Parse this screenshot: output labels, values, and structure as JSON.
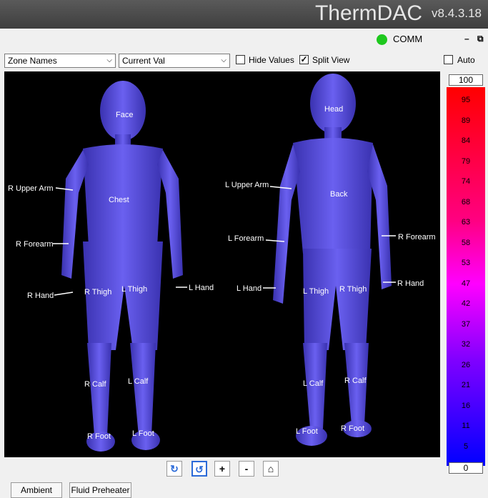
{
  "app": {
    "title": "ThermDAC",
    "version": "v8.4.3.18"
  },
  "status": {
    "comm_label": "COMM",
    "comm_color": "#1ec81e"
  },
  "window_controls": {
    "minimize": "–",
    "restore": "⧉"
  },
  "toolbar": {
    "zone_select": "Zone Names",
    "value_select": "Current Val",
    "hide_values": {
      "label": "Hide Values",
      "checked": false
    },
    "split_view": {
      "label": "Split View",
      "checked": true
    },
    "auto": {
      "label": "Auto",
      "checked": false
    }
  },
  "front_labels": [
    "Face",
    "Chest",
    "R Upper Arm",
    "R Forearm",
    "R Hand",
    "R Thigh",
    "L Thigh",
    "L Hand",
    "R Calf",
    "L Calf",
    "R Foot",
    "L Foot"
  ],
  "back_labels": [
    "Head",
    "Back",
    "L Upper Arm",
    "L Forearm",
    "R Forearm",
    "L Hand",
    "L Thigh",
    "R Thigh",
    "R Hand",
    "L Calf",
    "R Calf",
    "L Foot",
    "R Foot"
  ],
  "scale": {
    "max": "100",
    "min": "0",
    "ticks": [
      "95",
      "89",
      "84",
      "79",
      "74",
      "68",
      "63",
      "58",
      "53",
      "47",
      "42",
      "37",
      "32",
      "26",
      "21",
      "16",
      "11",
      "5"
    ],
    "top_color": "#ff0000",
    "bottom_color": "#0000ff"
  },
  "body_color": "#5a50e6",
  "bottom_buttons": {
    "ambient": "Ambient",
    "fluid_preheater": "Fluid Preheater"
  }
}
